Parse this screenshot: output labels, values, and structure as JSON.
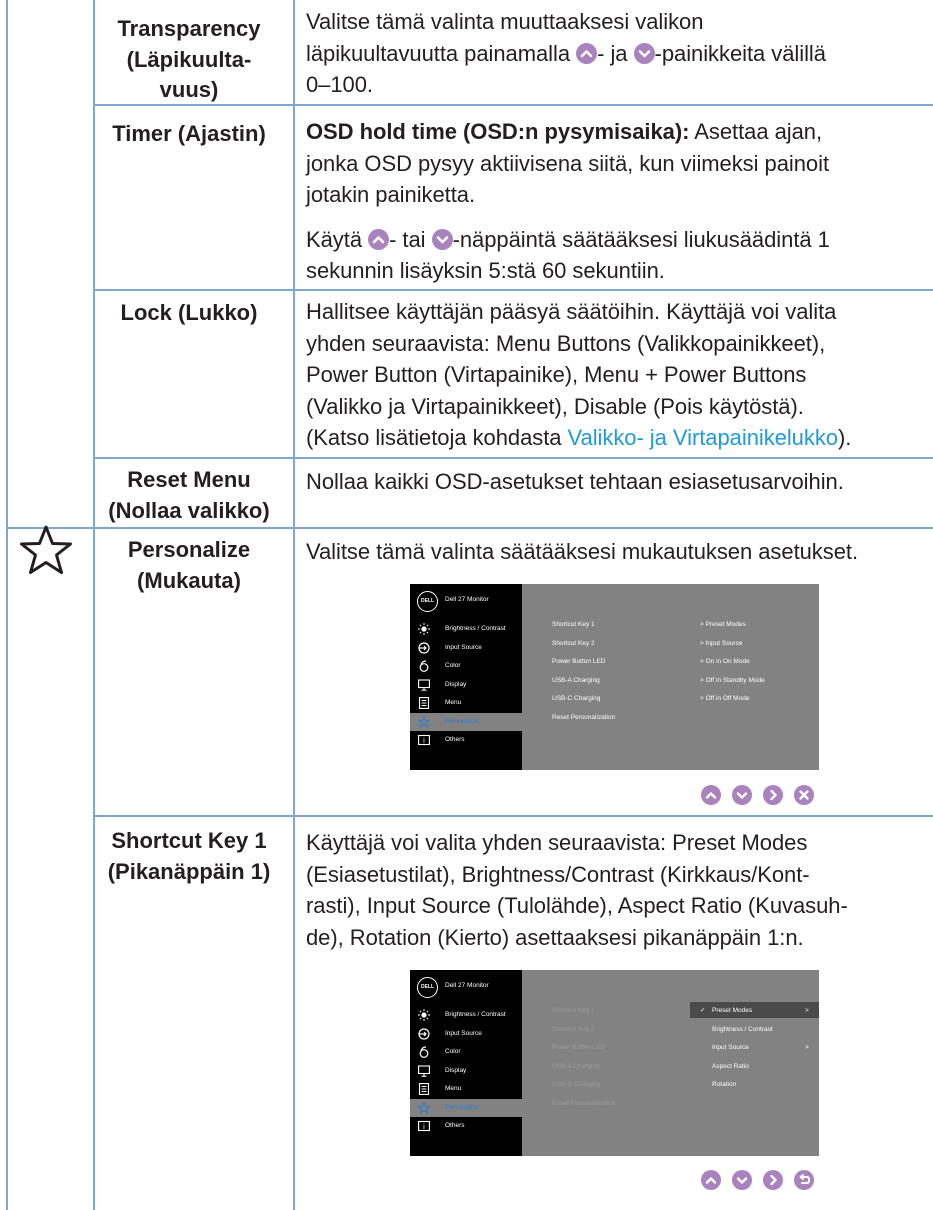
{
  "rows": [
    {
      "label": [
        "Transparency",
        "(Läpikuulta-",
        "vuus)"
      ],
      "lines": [
        "Valitse tämä valinta muuttaaksesi valikon",
        "läpikuultavuutta painamalla",
        "-painikkeita välillä",
        "0–100."
      ],
      "and_word": "- ja"
    },
    {
      "label": [
        "Timer (Ajastin)"
      ],
      "bold_lead": "OSD hold time (OSD:n pysymisaika):",
      "lines": [
        "Asettaa ajan,",
        "jonka OSD pysyy aktiivisena siitä, kun viimeksi painoit",
        "jotakin painiketta."
      ],
      "p2": [
        "Käytä",
        "- tai",
        "-näppäintä säätääksesi liukusäädintä 1",
        "sekunnin lisäyksin 5:stä 60 sekuntiin."
      ]
    },
    {
      "label": [
        "Lock (Lukko)"
      ],
      "lines": [
        "Hallitsee käyttäjän pääsyä säätöihin. Käyttäjä voi valita",
        "yhden seuraavista: Menu Buttons (Valikkopainikkeet),",
        "Power Button (Virtapainike), Menu + Power Buttons",
        "(Valikko ja Virtapainikkeet), Disable (Pois käytöstä).",
        "(Katso lisätietoja kohdasta",
        "Valikko- ja Virtapainikelukko",
        ")."
      ]
    },
    {
      "label": [
        "Reset Menu",
        "(Nollaa valikko)"
      ],
      "lines": [
        "Nollaa kaikki OSD-asetukset tehtaan esiasetusarvoihin."
      ]
    },
    {
      "label": [
        "Personalize",
        "(Mukauta)"
      ],
      "lines": [
        "Valitse tämä valinta säätääksesi mukautuksen asetukset."
      ]
    },
    {
      "label": [
        "Shortcut Key 1",
        "(Pikanäppäin 1)"
      ],
      "lines": [
        "Käyttäjä voi valita yhden seuraavista: Preset Modes",
        "(Esiasetustilat), Brightness/Contrast (Kirkkaus/Kont-",
        "rasti), Input Source (Tulolähde), Aspect Ratio (Kuvasuh-",
        "de), Rotation (Kierto) asettaaksesi pikanäppäin 1:n."
      ]
    }
  ],
  "osd": {
    "logo": "DELL",
    "model": "Dell 27 Monitor",
    "menu": [
      "Brightness / Contrast",
      "Input Source",
      "Color",
      "Display",
      "Menu",
      "Personalize",
      "Others"
    ],
    "menu_icons": [
      "brightness-icon",
      "input-source-icon",
      "color-icon",
      "display-icon",
      "menu-icon",
      "star-icon",
      "others-icon"
    ],
    "sub": [
      "Shortcut Key 1",
      "Shortcut Key 2",
      "Power Button LED",
      "USB-A Charging",
      "USB-C Charging",
      "Reset Personalization"
    ],
    "vals": [
      "Preset Modes",
      "Input Source",
      "On in On Mode",
      "Off in Standby Mode",
      "Off in Off Mode"
    ],
    "options": [
      "Preset Modes",
      "Brightness / Contrast",
      "Input Source",
      "Aspect Ratio",
      "Rotation"
    ]
  },
  "colors": {
    "accent": "#a883be",
    "rule": "#7fa7c9",
    "link": "#1f9bd6"
  }
}
